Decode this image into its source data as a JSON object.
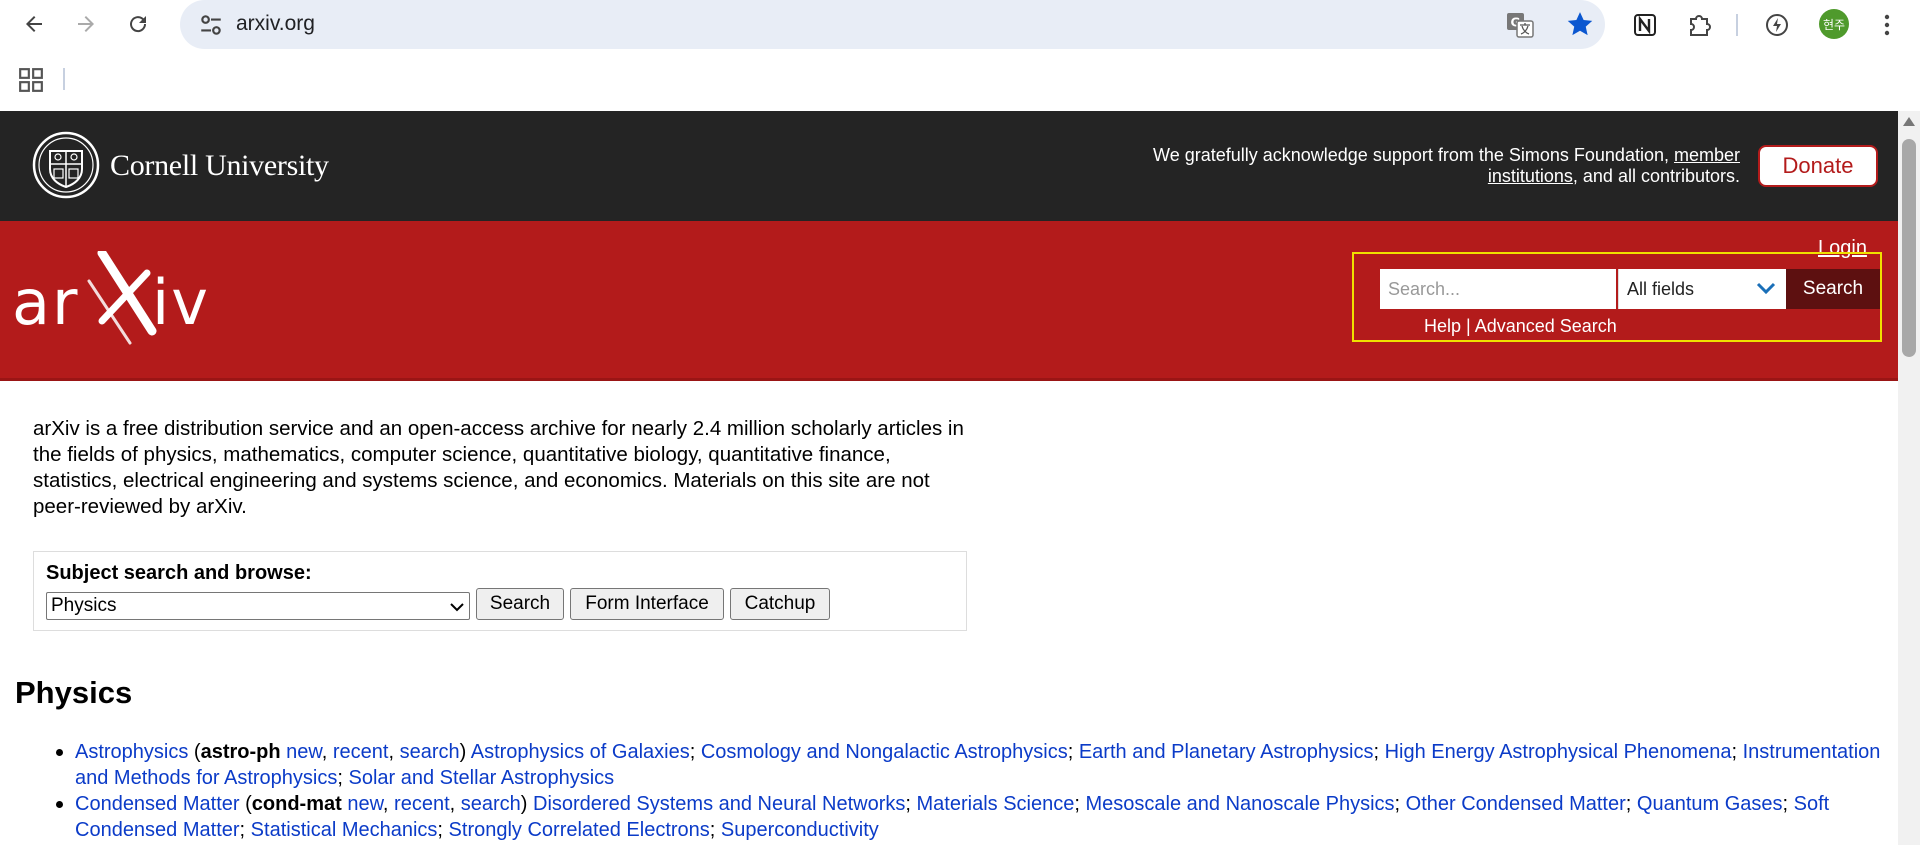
{
  "browser": {
    "url": "arxiv.org",
    "avatar_text": "현주"
  },
  "header": {
    "institution": "Cornell University",
    "support_text_before": "We gratefully acknowledge support from the Simons Foundation, ",
    "support_link": "member institutions",
    "support_text_after": ", and all contributors.",
    "donate_label": "Donate"
  },
  "banner": {
    "login_label": "Login",
    "search_placeholder": "Search...",
    "field_selected": "All fields",
    "search_button": "Search",
    "help_link": "Help",
    "separator": " | ",
    "advanced_link": "Advanced Search"
  },
  "intro": "arXiv is a free distribution service and an open-access archive for nearly 2.4 million scholarly articles in the fields of physics, mathematics, computer science, quantitative biology, quantitative finance, statistics, electrical engineering and systems science, and economics. Materials on this site are not peer-reviewed by arXiv.",
  "subject": {
    "title": "Subject search and browse:",
    "selected": "Physics",
    "buttons": [
      "Search",
      "Form Interface",
      "Catchup"
    ]
  },
  "section": {
    "heading": "Physics",
    "items": [
      {
        "name": "Astrophysics",
        "code": "astro-ph",
        "links": [
          "new",
          "recent",
          "search"
        ],
        "subcategories": [
          "Astrophysics of Galaxies",
          "Cosmology and Nongalactic Astrophysics",
          "Earth and Planetary Astrophysics",
          "High Energy Astrophysical Phenomena",
          "Instrumentation and Methods for Astrophysics",
          "Solar and Stellar Astrophysics"
        ]
      },
      {
        "name": "Condensed Matter",
        "code": "cond-mat",
        "links": [
          "new",
          "recent",
          "search"
        ],
        "subcategories": [
          "Disordered Systems and Neural Networks",
          "Materials Science",
          "Mesoscale and Nanoscale Physics",
          "Other Condensed Matter",
          "Quantum Gases",
          "Soft Condensed Matter",
          "Statistical Mechanics",
          "Strongly Correlated Electrons",
          "Superconductivity"
        ]
      }
    ]
  },
  "colors": {
    "arxiv_red": "#b31b1b",
    "cornell_dark": "#242424",
    "link_blue": "#0b3bc8",
    "highlight_yellow": "#f0e000"
  }
}
